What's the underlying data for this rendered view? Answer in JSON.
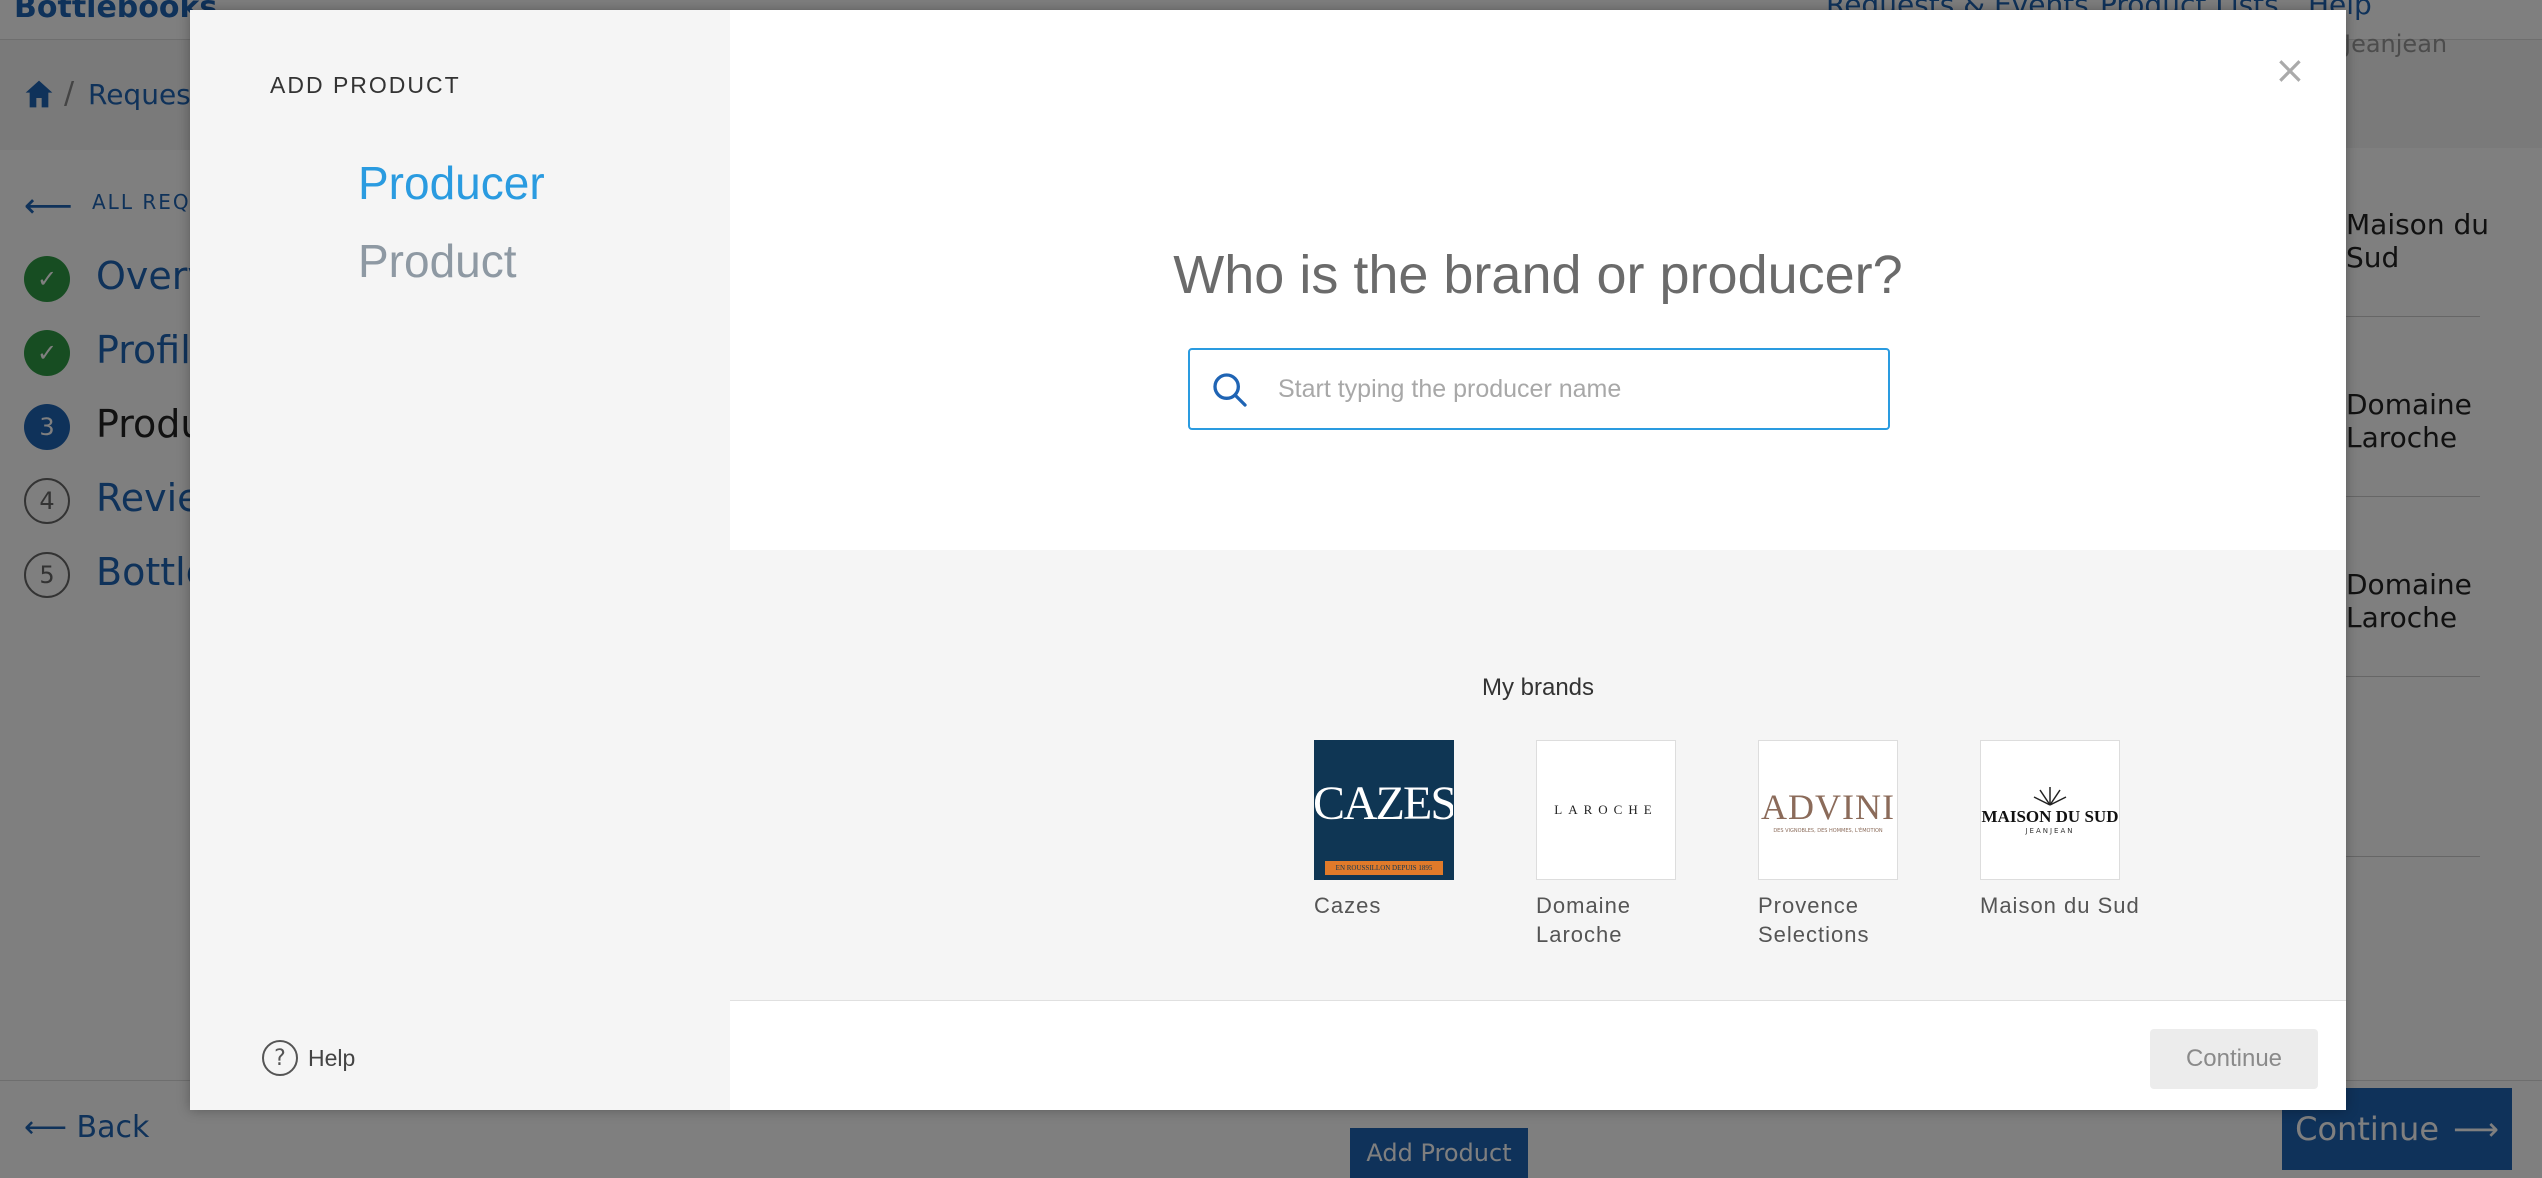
{
  "background": {
    "app_name": "Bottlebooks",
    "nav": [
      "Requests & Events",
      "Product Lists",
      "Help"
    ],
    "breadcrumb": "Requests",
    "user": "Jeanjean",
    "all_requests": "ALL REQUESTS",
    "steps": [
      {
        "number": "✓",
        "label": "Overview",
        "state": "done"
      },
      {
        "number": "✓",
        "label": "Profile",
        "state": "done"
      },
      {
        "number": "3",
        "label": "Products",
        "state": "active"
      },
      {
        "number": "4",
        "label": "Review",
        "state": "todo"
      },
      {
        "number": "5",
        "label": "Bottles",
        "state": "todo"
      }
    ],
    "right_items": [
      "Maison du Sud",
      "Domaine Laroche",
      "Domaine Laroche"
    ],
    "back_label": "Back",
    "add_product_label": "Add Product",
    "continue_label": "Continue"
  },
  "modal": {
    "heading": "ADD PRODUCT",
    "steps": [
      "Producer",
      "Product"
    ],
    "help_label": "Help",
    "close_symbol": "×",
    "question": "Who is the brand or producer?",
    "search": {
      "placeholder": "Start typing the producer name",
      "value": ""
    },
    "brands_title": "My brands",
    "brands": [
      {
        "name": "Cazes",
        "logo_text": "CAZES",
        "logo_subtext": "EN ROUSSILLON DEPUIS 1895"
      },
      {
        "name": "Domaine Laroche",
        "logo_text": "LAROCHE",
        "logo_subtext": ""
      },
      {
        "name": "Provence Selections",
        "logo_text": "ADVINI",
        "logo_subtext": "DES VIGNOBLES, DES HOMMES, L'ÉMOTION"
      },
      {
        "name": "Maison du Sud",
        "logo_text": "MAISON DU SUD",
        "logo_subtext": "JEANJEAN"
      }
    ],
    "continue_label": "Continue"
  },
  "colors": {
    "accent": "#2a9be0",
    "brand_blue": "#1f64b4",
    "done_green": "#2e9b45",
    "cazes_bg": "#0f3654",
    "cazes_band": "#e07a2a",
    "advini_text": "#8b6b5a"
  }
}
